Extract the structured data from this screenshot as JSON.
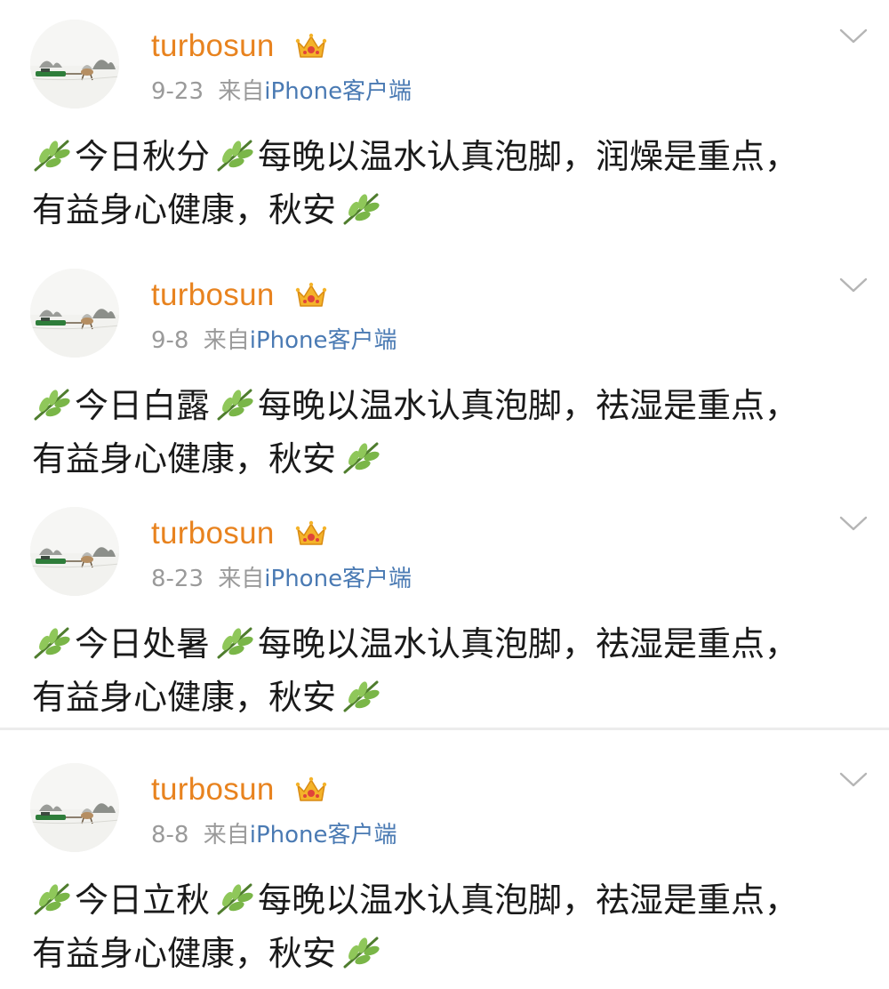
{
  "posts": [
    {
      "username": "turbosun",
      "date": "9-23",
      "source_prefix": "来自",
      "source_app": "iPhone客户端",
      "term": "今日秋分",
      "body": "每晚以温水认真泡脚，润燥是重点，有益身心健康，秋安"
    },
    {
      "username": "turbosun",
      "date": "9-8",
      "source_prefix": "来自",
      "source_app": "iPhone客户端",
      "term": "今日白露",
      "body": "每晚以温水认真泡脚，祛湿是重点，有益身心健康，秋安"
    },
    {
      "username": "turbosun",
      "date": "8-23",
      "source_prefix": "来自",
      "source_app": "iPhone客户端",
      "term": "今日处暑",
      "body": "每晚以温水认真泡脚，祛湿是重点，有益身心健康，秋安"
    },
    {
      "username": "turbosun",
      "date": "8-8",
      "source_prefix": "来自",
      "source_app": "iPhone客户端",
      "term": "今日立秋",
      "body": "每晚以温水认真泡脚，祛湿是重点，有益身心健康，秋安"
    }
  ],
  "icons": {
    "avatar": "snowy-landscape-sled-avatar",
    "badge": "crown-icon",
    "menu": "chevron-down-icon",
    "emoji": "leaf-icon"
  },
  "colors": {
    "username": "#e8831f",
    "meta": "#9a9a9a",
    "source_link": "#4a7ab3",
    "text": "#1a1a1a",
    "divider": "#ececec"
  }
}
